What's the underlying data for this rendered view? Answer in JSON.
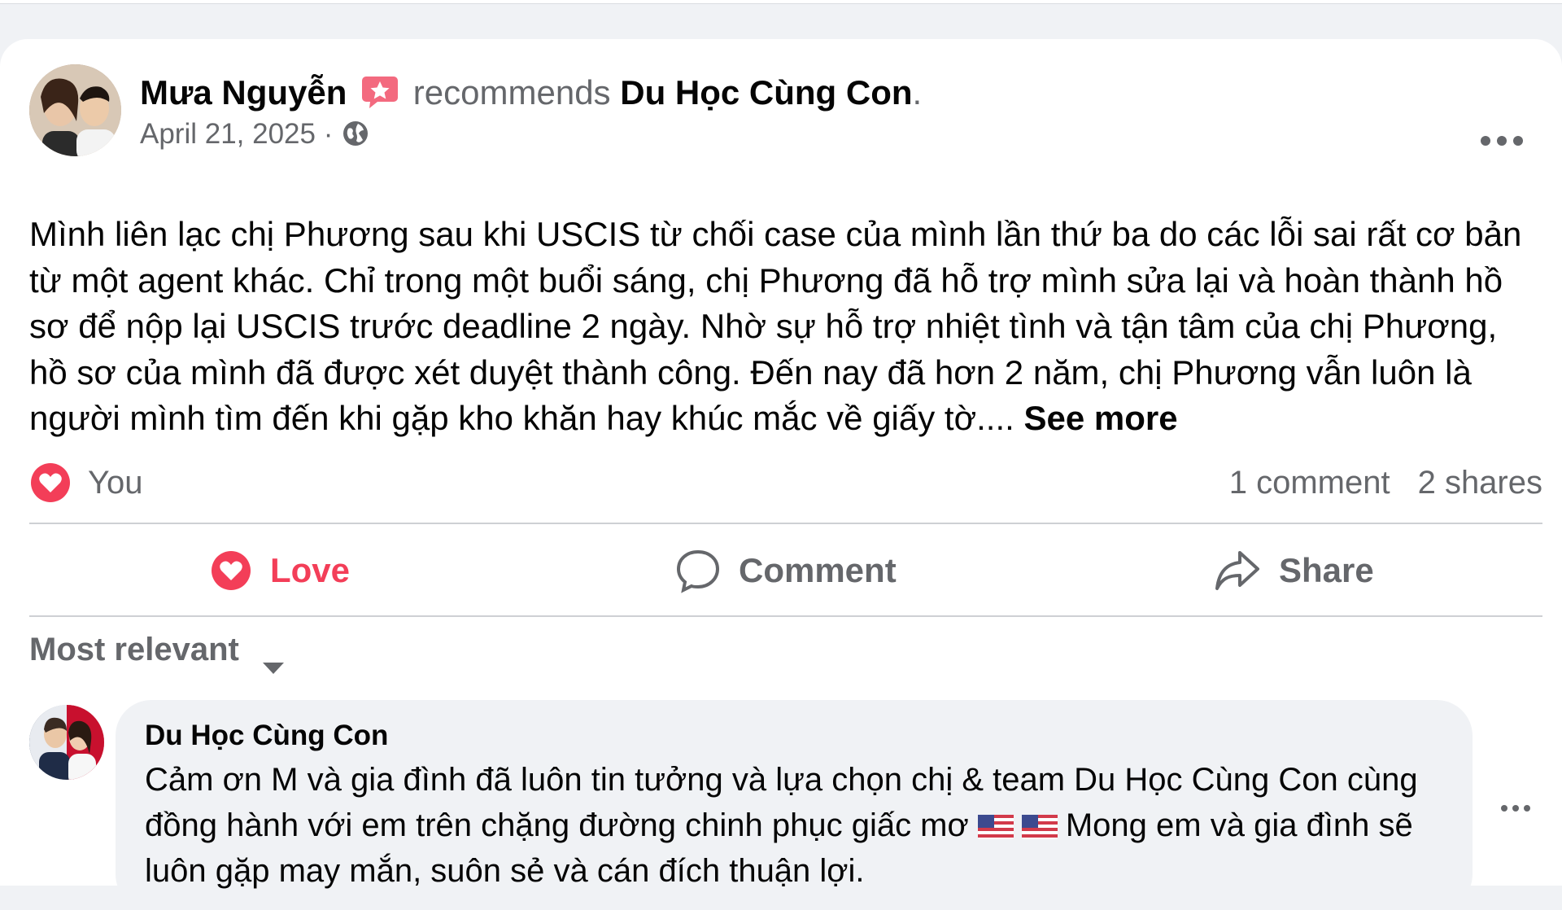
{
  "post": {
    "author": "Mưa Nguyễn",
    "recommends": "recommends",
    "page": "Du Học Cùng Con",
    "page_suffix": ".",
    "date": "April 21, 2025",
    "date_separator": "·",
    "audience_icon": "globe-icon",
    "body": "Mình liên lạc chị Phương sau khi USCIS từ chối case của mình lần thứ ba do các lỗi sai rất cơ bản từ một agent khác. Chỉ trong một buổi sáng, chị Phương đã hỗ trợ mình sửa lại và hoàn thành hồ sơ để nộp lại USCIS trước deadline 2 ngày. Nhờ sự hỗ trợ nhiệt tình và tận tâm của chị Phương, hồ sơ của mình đã được xét duyệt thành công. Đến nay đã hơn 2 năm, chị Phương vẫn luôn là người mình tìm đến khi gặp kho khăn hay khúc mắc về giấy tờ....",
    "see_more": "See more"
  },
  "reactions": {
    "reactors": "You",
    "comments": "1 comment",
    "shares": "2 shares"
  },
  "actions": {
    "love": "Love",
    "comment": "Comment",
    "share": "Share"
  },
  "sort": {
    "label": "Most relevant"
  },
  "comment": {
    "author": "Du Học Cùng Con",
    "text_part1": "Cảm ơn M và gia đình đã luôn tin tưởng và lựa chọn chị & team Du Học Cùng Con cùng đồng hành với em trên chặng đường chinh phục giấc mơ ",
    "text_part2": "Mong em và gia đình sẽ luôn gặp may mắn, suôn sẻ và cán đích thuận lợi."
  },
  "colors": {
    "love": "#f33e58",
    "secondary_text": "#65676b",
    "bubble": "#f0f2f5"
  }
}
